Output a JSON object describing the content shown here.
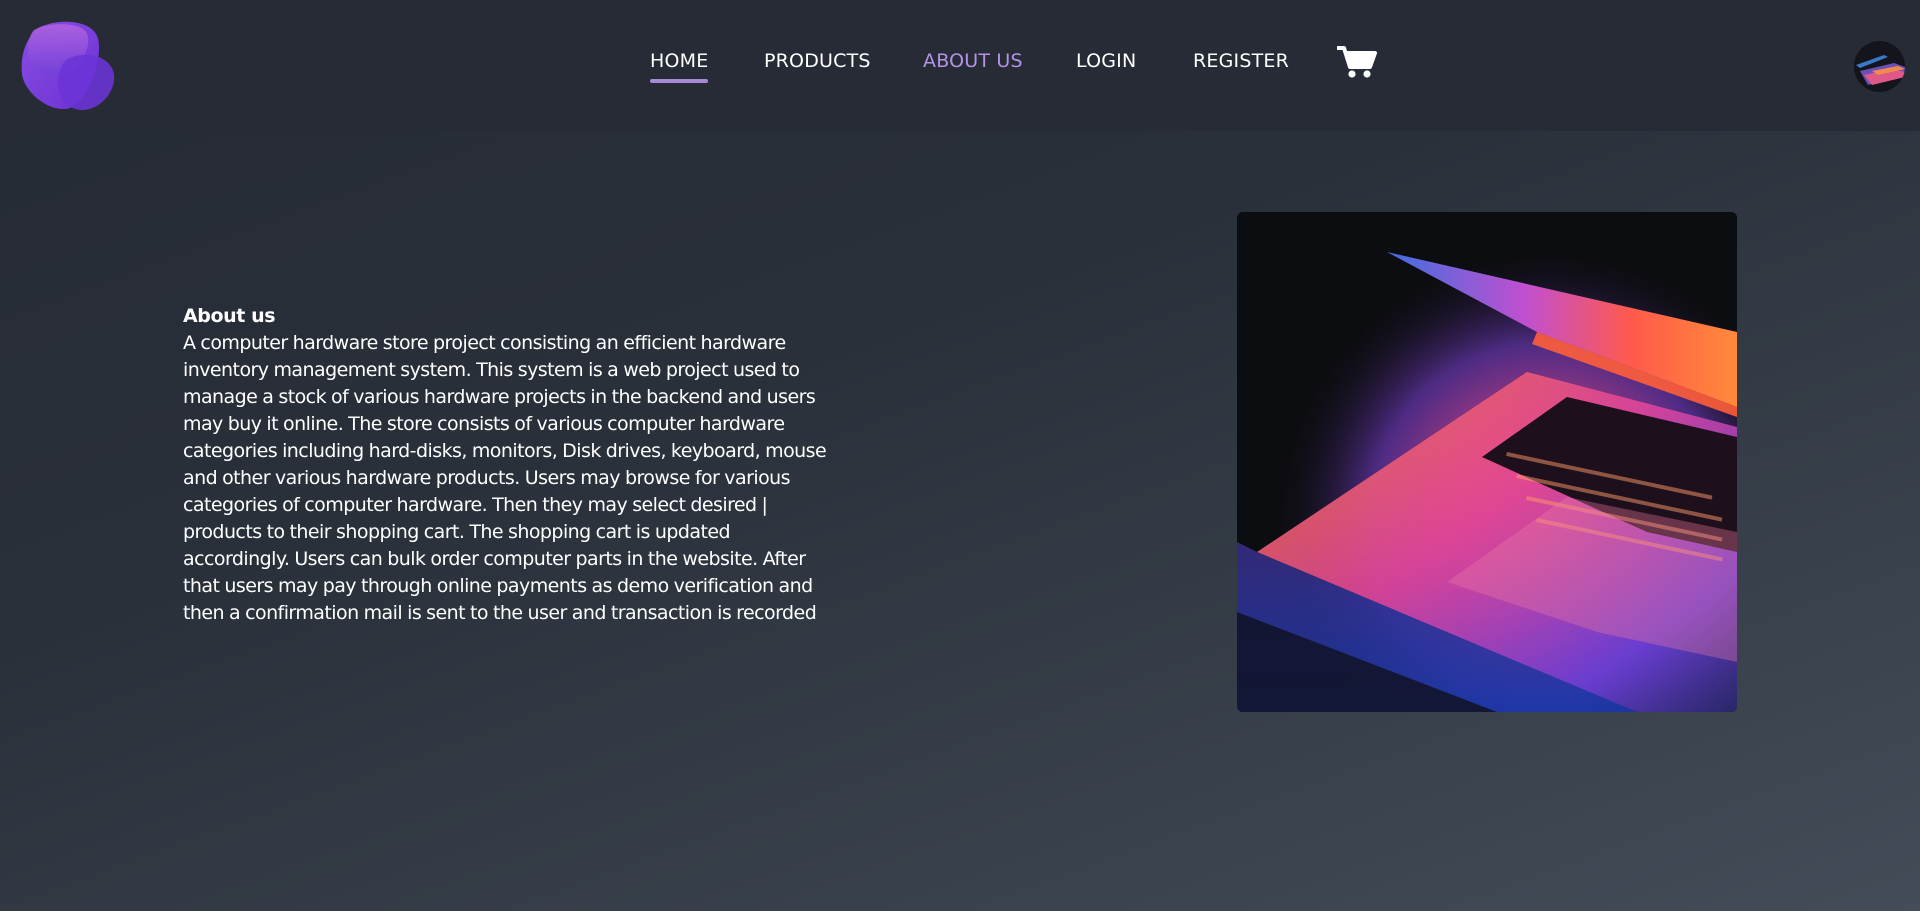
{
  "nav": {
    "links": [
      {
        "label": "HOME"
      },
      {
        "label": "PRODUCTS"
      },
      {
        "label": "ABOUT US"
      },
      {
        "label": "LOGIN"
      },
      {
        "label": "REGISTER"
      }
    ],
    "cart_icon": "shopping-cart-icon",
    "logo_icon": "brand-logo",
    "avatar_icon": "user-avatar"
  },
  "about": {
    "title": "About us",
    "lines": [
      "A computer hardware store project consisting an efficient hardware",
      "inventory management system. This system is a web project used to",
      "manage a stock of various hardware projects in the backend and users",
      "may buy it online. The store consists of various computer hardware",
      "categories including hard-disks, monitors, Disk drives, keyboard, mouse",
      "and other various hardware products. Users may browse for various",
      "categories of computer hardware. Then they may select desired |",
      "products to their shopping cart. The shopping cart is updated",
      "accordingly. Users can bulk order computer parts in the website. After",
      "that users may pay through online payments as demo verification and",
      "then a confirmation mail is sent to the user and transaction is recorded"
    ]
  },
  "colors": {
    "navbar_bg": "#262b35",
    "accent": "#b493e6",
    "underline": "#a68ad6"
  }
}
